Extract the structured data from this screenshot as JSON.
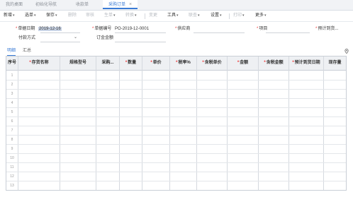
{
  "tabs": [
    {
      "label": "我的桌面"
    },
    {
      "label": "初始化导航"
    },
    {
      "label": "收款单"
    },
    {
      "label": "采购订单"
    }
  ],
  "active_tab_close": "×",
  "toolbar": {
    "new": "新增",
    "select_source": "选单",
    "save": "保存",
    "delete": "删除",
    "audit": "审核",
    "generate": "生单",
    "convert": "转换",
    "change": "变更",
    "tools": "工具",
    "link_query": "联查",
    "settings": "设置",
    "print": "打印",
    "more": "更多"
  },
  "header": {
    "doc_date_label": "单据日期",
    "doc_date_value": "2019-12-16",
    "doc_no_label": "单据编号",
    "doc_no_value": "PO-2019-12-0001",
    "supplier_label": "供应商",
    "project_label": "项目",
    "expected_arrival_label": "预计到货...",
    "payment_method_label": "付款方式",
    "deposit_label": "订金金额"
  },
  "subtabs": [
    {
      "label": "明细"
    },
    {
      "label": "汇总"
    }
  ],
  "table": {
    "columns": [
      {
        "label": "序号",
        "required": false
      },
      {
        "label": "存货名称",
        "required": true
      },
      {
        "label": "规格型号",
        "required": false
      },
      {
        "label": "采购...",
        "required": false
      },
      {
        "label": "数量",
        "required": true
      },
      {
        "label": "单价",
        "required": true
      },
      {
        "label": "税率%",
        "required": true
      },
      {
        "label": "含税单价",
        "required": true
      },
      {
        "label": "金额",
        "required": true
      },
      {
        "label": "含税金额",
        "required": true
      },
      {
        "label": "预计到货日期",
        "required": true
      },
      {
        "label": "现存量",
        "required": false
      }
    ],
    "row_numbers": [
      "1",
      "2",
      "3",
      "4",
      "5",
      "6",
      "7",
      "8",
      "9",
      "10",
      "11",
      "12",
      "13"
    ]
  }
}
